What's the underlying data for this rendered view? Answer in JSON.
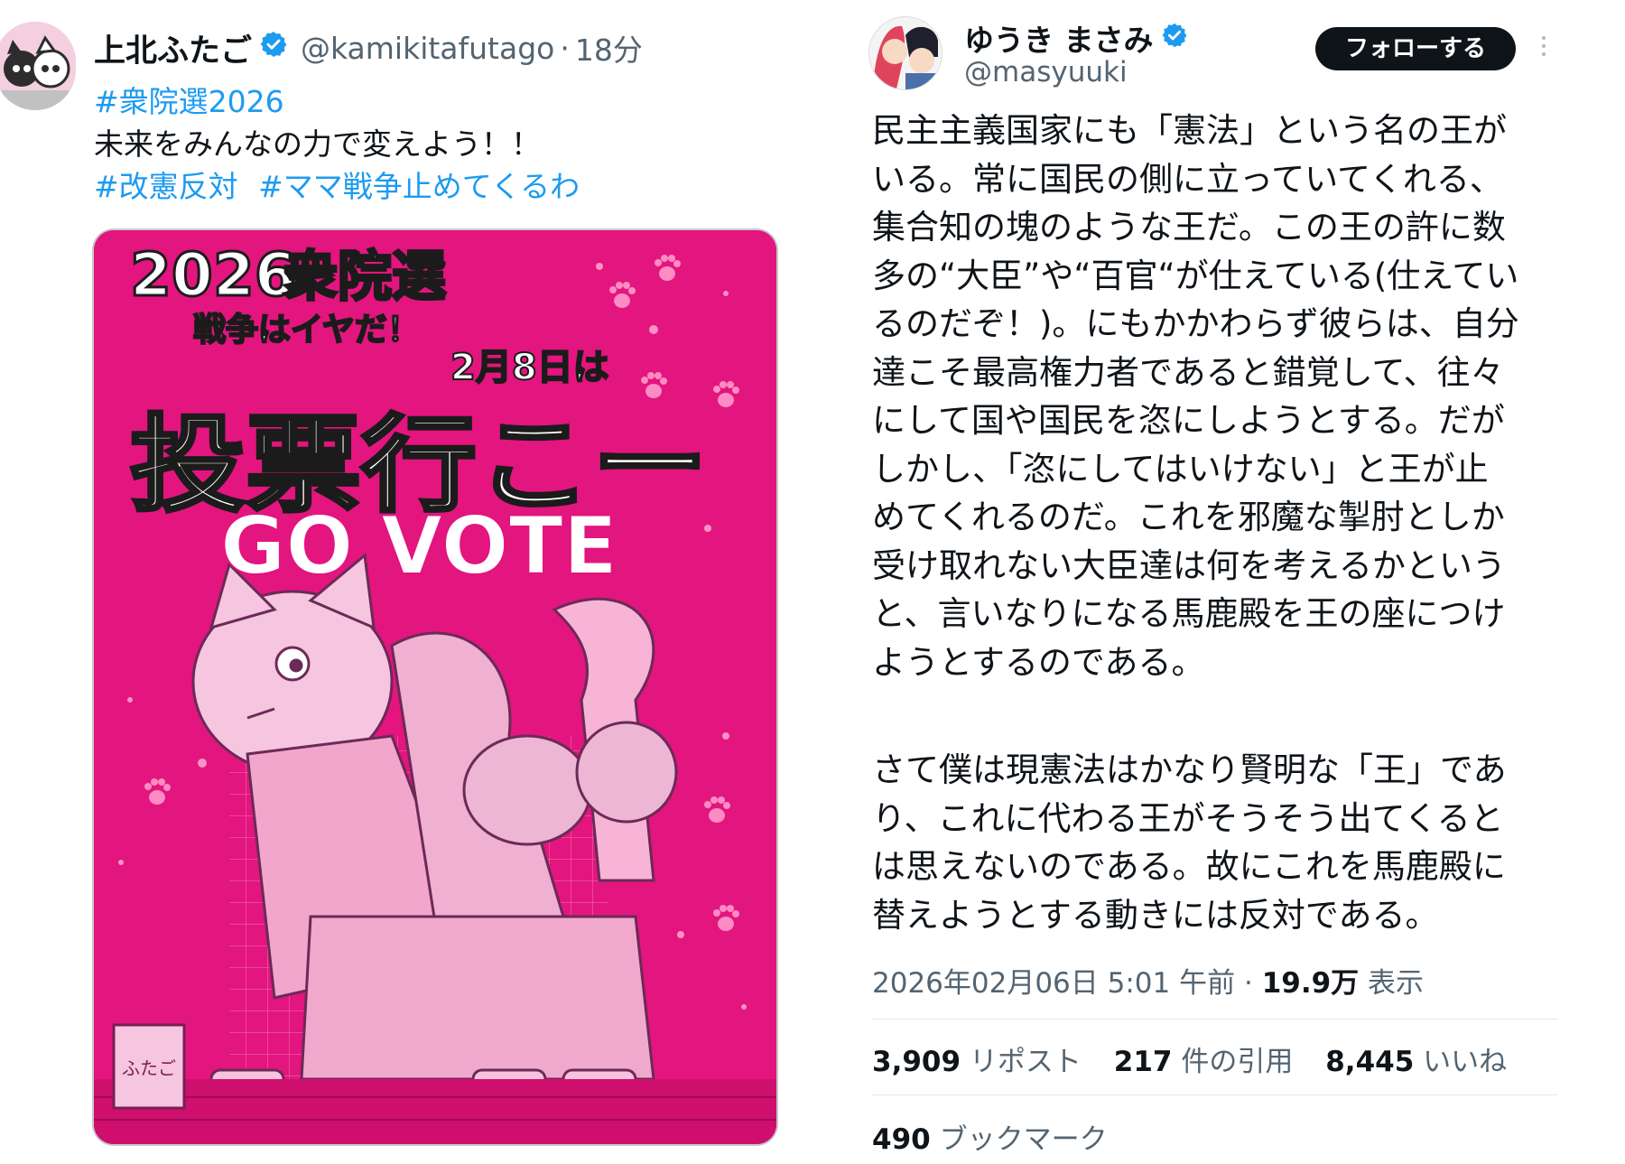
{
  "left_tweet": {
    "name": "上北ふたご",
    "handle": "@kamikitafutago",
    "time": "18分",
    "hashtag_line": "#衆院選2026",
    "text": "未来をみんなの力で変えよう！！",
    "hashtags": [
      "#改憲反対",
      "#ママ戦争止めてくるわ"
    ],
    "poster": {
      "year": "2026",
      "election": "衆院選",
      "slogan": "戦争はイヤだ！",
      "date": "2月8日は",
      "headline": "投票行こー",
      "subheadline": "GO VOTE",
      "seal": "ふたご"
    }
  },
  "right_tweet": {
    "name": "ゆうき まさみ",
    "handle": "@masyuuki",
    "follow_label": "フォローする",
    "paragraph1": [
      "民主主義国家にも「憲法」という名の王が",
      "いる。常に国民の側に立っていてくれる、",
      "集合知の塊のような王だ。この王の許に数",
      "多の“大臣”や“百官“が仕えている(仕えてい",
      "るのだぞ！)。にもかかわらず彼らは、自分",
      "達こそ最高権力者であると錯覚して、往々",
      "にして国や国民を恣にしようとする。だが",
      "しかし、「恣にしてはいけない」と王が止",
      "めてくれるのだ。これを邪魔な掣肘としか",
      "受け取れない大臣達は何を考えるかという",
      "と、言いなりになる馬鹿殿を王の座につけ",
      "ようとするのである。"
    ],
    "paragraph2": [
      "さて僕は現憲法はかなり賢明な「王」であ",
      "り、これに代わる王がそうそう出てくると",
      "は思えないのである。故にこれを馬鹿殿に",
      "替えようとする動きには反対である。"
    ],
    "timestamp": "2026年02月06日 5:01 午前",
    "views_count": "19.9万",
    "views_label": "表示",
    "reposts_count": "3,909",
    "reposts_label": "リポスト",
    "quotes_count": "217",
    "quotes_label": "件の引用",
    "likes_count": "8,445",
    "likes_label": "いいね",
    "bookmarks_count": "490",
    "bookmarks_label": "ブックマーク"
  },
  "colors": {
    "link": "#1d9bf0",
    "verified": "#1d9bf0",
    "poster_bg": "#e3157f",
    "muted": "#536471"
  },
  "icons": [
    "verified-badge-icon",
    "more-options-icon"
  ]
}
